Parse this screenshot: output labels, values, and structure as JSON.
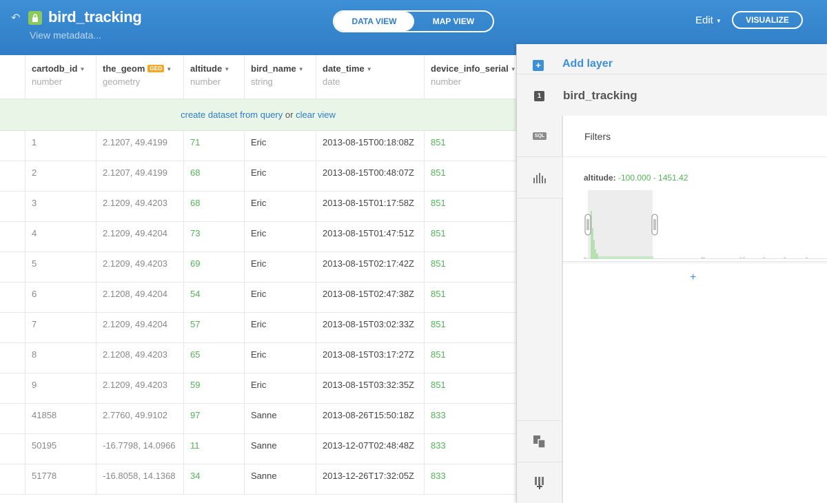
{
  "header": {
    "title": "bird_tracking",
    "metadata_link": "View metadata...",
    "tabs": [
      "DATA VIEW",
      "MAP VIEW"
    ],
    "edit_label": "Edit",
    "visualize_label": "VISUALIZE"
  },
  "table": {
    "columns": [
      {
        "name": "cartodb_id",
        "type": "number"
      },
      {
        "name": "the_geom",
        "type": "geometry",
        "badge": "GEO"
      },
      {
        "name": "altitude",
        "type": "number"
      },
      {
        "name": "bird_name",
        "type": "string"
      },
      {
        "name": "date_time",
        "type": "date"
      },
      {
        "name": "device_info_serial",
        "type": "number"
      }
    ],
    "banner": {
      "link1": "create dataset from query",
      "middle": " or ",
      "link2": "clear view"
    },
    "rows": [
      [
        "1",
        "2.1207, 49.4199",
        "71",
        "Eric",
        "2013-08-15T00:18:08Z",
        "851"
      ],
      [
        "2",
        "2.1207, 49.4199",
        "68",
        "Eric",
        "2013-08-15T00:48:07Z",
        "851"
      ],
      [
        "3",
        "2.1209, 49.4203",
        "68",
        "Eric",
        "2013-08-15T01:17:58Z",
        "851"
      ],
      [
        "4",
        "2.1209, 49.4204",
        "73",
        "Eric",
        "2013-08-15T01:47:51Z",
        "851"
      ],
      [
        "5",
        "2.1209, 49.4203",
        "69",
        "Eric",
        "2013-08-15T02:17:42Z",
        "851"
      ],
      [
        "6",
        "2.1208, 49.4204",
        "54",
        "Eric",
        "2013-08-15T02:47:38Z",
        "851"
      ],
      [
        "7",
        "2.1209, 49.4204",
        "57",
        "Eric",
        "2013-08-15T03:02:33Z",
        "851"
      ],
      [
        "8",
        "2.1208, 49.4203",
        "65",
        "Eric",
        "2013-08-15T03:17:27Z",
        "851"
      ],
      [
        "9",
        "2.1209, 49.4203",
        "59",
        "Eric",
        "2013-08-15T03:32:35Z",
        "851"
      ],
      [
        "41858",
        "2.7760, 49.9102",
        "97",
        "Sanne",
        "2013-08-26T15:50:18Z",
        "833"
      ],
      [
        "50195",
        "-16.7798, 14.0966",
        "11",
        "Sanne",
        "2013-12-07T02:48:48Z",
        "833"
      ],
      [
        "51778",
        "-16.8058, 14.1368",
        "34",
        "Sanne",
        "2013-12-26T17:32:05Z",
        "833"
      ]
    ]
  },
  "panel": {
    "add_layer": "Add layer",
    "layer_number": "1",
    "layer_name": "bird_tracking",
    "sql_label": "SQL",
    "filters_title": "Filters",
    "filter": {
      "name": "altitude:",
      "range": "-100.000 - 1451.42",
      "selected_min_fraction": 0.0,
      "selected_max_fraction": 0.6
    },
    "add_filter": "+"
  },
  "colors": {
    "header_blue": "#2f7dc6",
    "accent_green": "#53b356",
    "geo_badge": "#f3a825"
  }
}
